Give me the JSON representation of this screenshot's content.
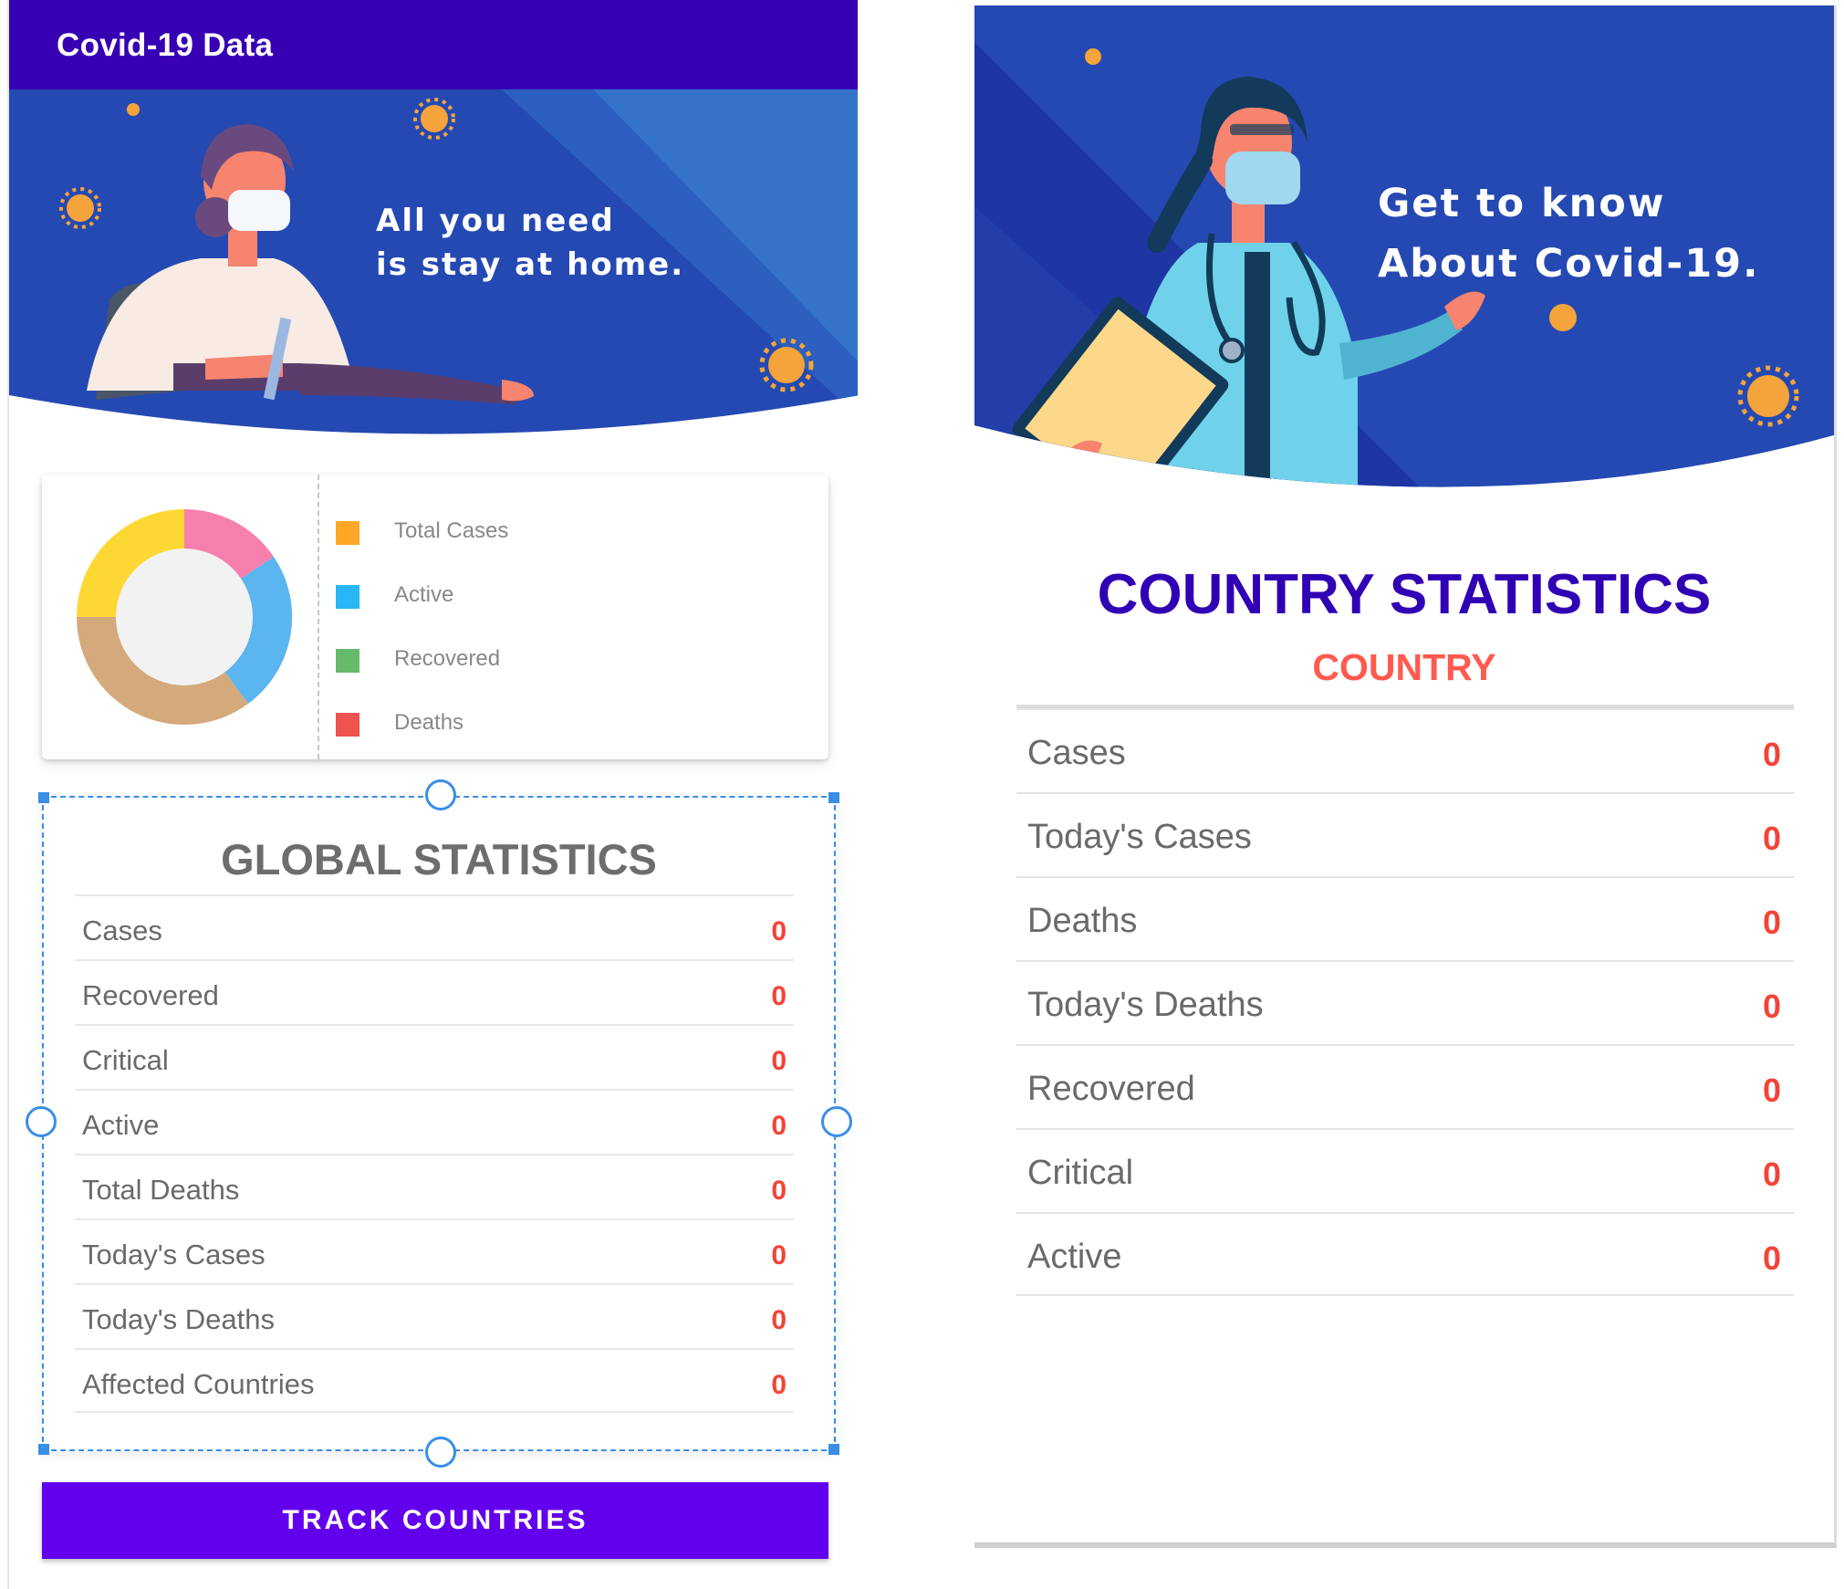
{
  "left_screen": {
    "app_bar": {
      "title": "Covid-19 Data"
    },
    "hero": {
      "line1": "All you need",
      "line2": "is stay at home."
    },
    "chart_card": {
      "legend": [
        {
          "label": "Total Cases",
          "color": "#ffa726"
        },
        {
          "label": "Active",
          "color": "#29b6f6"
        },
        {
          "label": "Recovered",
          "color": "#66bb6a"
        },
        {
          "label": "Deaths",
          "color": "#ef5350"
        }
      ]
    },
    "global_statistics": {
      "title": "GLOBAL STATISTICS",
      "rows": [
        {
          "label": "Cases",
          "value": "0"
        },
        {
          "label": "Recovered",
          "value": "0"
        },
        {
          "label": "Critical",
          "value": "0"
        },
        {
          "label": "Active",
          "value": "0"
        },
        {
          "label": "Total Deaths",
          "value": "0"
        },
        {
          "label": "Today's Cases",
          "value": "0"
        },
        {
          "label": "Today's Deaths",
          "value": "0"
        },
        {
          "label": "Affected Countries",
          "value": "0"
        }
      ]
    },
    "track_button": {
      "label": "TRACK COUNTRIES"
    }
  },
  "right_screen": {
    "hero": {
      "line1": "Get to know",
      "line2": "About Covid-19."
    },
    "country_statistics": {
      "title": "COUNTRY STATISTICS",
      "subtitle": "COUNTRY",
      "rows": [
        {
          "label": "Cases",
          "value": "0"
        },
        {
          "label": "Today's Cases",
          "value": "0"
        },
        {
          "label": "Deaths",
          "value": "0"
        },
        {
          "label": "Today's Deaths",
          "value": "0"
        },
        {
          "label": "Recovered",
          "value": "0"
        },
        {
          "label": "Critical",
          "value": "0"
        },
        {
          "label": "Active",
          "value": "0"
        }
      ]
    }
  },
  "colors": {
    "app_bar": "#3700b3",
    "button": "#6200ee",
    "value_red": "#f44336",
    "country_title": "#3100b5",
    "country_subtitle": "#ff5a4f",
    "selection": "#3a8ee6"
  },
  "icons": {
    "donut_chart": "pie-chart-icon",
    "hero_left": "nurse-illustration-icon",
    "hero_right": "doctor-illustration-icon",
    "virus": "virus-icon"
  }
}
